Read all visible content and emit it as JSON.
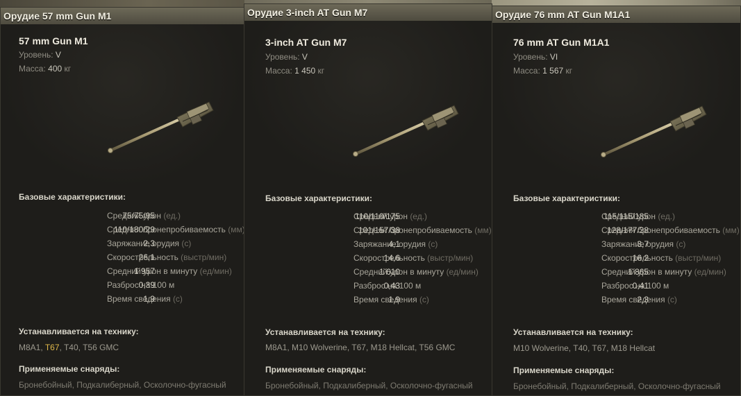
{
  "labels": {
    "level": "Уровень:",
    "mass": "Масса:",
    "mass_unit": "кг",
    "base_stats": "Базовые характеристики:",
    "installed_on": "Устанавливается на технику:",
    "ammo": "Применяемые снаряды:"
  },
  "stat_labels": [
    {
      "label": "Средний урон",
      "unit": "(ед.)"
    },
    {
      "label": "Средняя бронепробиваемость",
      "unit": "(мм)"
    },
    {
      "label": "Заряжание орудия",
      "unit": "(с)"
    },
    {
      "label": "Скорострельность",
      "unit": "(выстр/мин)"
    },
    {
      "label": "Средний урон в минуту",
      "unit": "(ед/мин)"
    },
    {
      "label": "Разброс на 100 м",
      "unit": ""
    },
    {
      "label": "Время сведения",
      "unit": "(с)"
    }
  ],
  "guns": [
    {
      "header": "Орудие 57 mm Gun M1",
      "name": "57 mm Gun M1",
      "level": "V",
      "mass": "400",
      "stats": [
        "75/75/95",
        "110/180/29",
        "2,3",
        "26,1",
        "1 957",
        "0,39",
        "1,9"
      ],
      "vehicles": [
        {
          "text": "M8A1, ",
          "highlight": false
        },
        {
          "text": "T67",
          "highlight": true
        },
        {
          "text": ", T40, T56 GMC",
          "highlight": false
        }
      ],
      "ammo": "Бронебойный, Подкалиберный, Осколочно-фугасный"
    },
    {
      "header": "Орудие 3-inch AT Gun M7",
      "name": "3-inch AT Gun M7",
      "level": "V",
      "mass": "1 450",
      "stats": [
        "110/110/175",
        "101/157/38",
        "4,1",
        "14,6",
        "1 610",
        "0,43",
        "1,9"
      ],
      "vehicles": [
        {
          "text": "M8A1, M10 Wolverine, T67, M18 Hellcat, T56 GMC",
          "highlight": false
        }
      ],
      "ammo": "Бронебойный, Подкалиберный, Осколочно-фугасный"
    },
    {
      "header": "Орудие 76 mm AT Gun M1A1",
      "name": "76 mm AT Gun M1A1",
      "level": "VI",
      "mass": "1 567",
      "stats": [
        "115/115/185",
        "128/177/38",
        "3,7",
        "16,2",
        "1 865",
        "0,41",
        "2,3"
      ],
      "vehicles": [
        {
          "text": "M10 Wolverine, T40, T67, M18 Hellcat",
          "highlight": false
        }
      ],
      "ammo": "Бронебойный, Подкалиберный, Осколочно-фугасный"
    }
  ]
}
